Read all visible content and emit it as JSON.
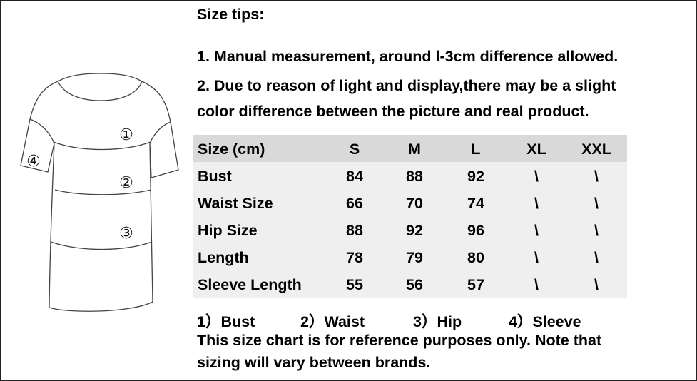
{
  "tips_title": "Size tips:",
  "tip1": "1. Manual measurement, around l-3cm difference allowed.",
  "tip2_line1": "2. Due to reason of light and display,there may be a slight",
  "tip2_line2": "color difference between the picture and real product.",
  "diagram": {
    "markers": [
      "①",
      "②",
      "③",
      "④"
    ]
  },
  "table": {
    "headers": [
      "Size (cm)",
      "S",
      "M",
      "L",
      "XL",
      "XXL"
    ],
    "rows": [
      [
        "Bust",
        "84",
        "88",
        "92",
        "\\",
        "\\"
      ],
      [
        "Waist Size",
        "66",
        "70",
        "74",
        "\\",
        "\\"
      ],
      [
        "Hip Size",
        "88",
        "92",
        "96",
        "\\",
        "\\"
      ],
      [
        "Length",
        "78",
        "79",
        "80",
        "\\",
        "\\"
      ],
      [
        "Sleeve Length",
        "55",
        "56",
        "57",
        "\\",
        "\\"
      ]
    ]
  },
  "legend": [
    "1）Bust",
    "2）Waist",
    "3）Hip",
    "4）Sleeve"
  ],
  "note_line1": "This size chart is for reference purposes only. Note that",
  "note_line2": "sizing will vary between brands.",
  "colors": {
    "header_bg": "#d9d9d9",
    "table_bg": "#efefef",
    "outline": "#444444"
  }
}
